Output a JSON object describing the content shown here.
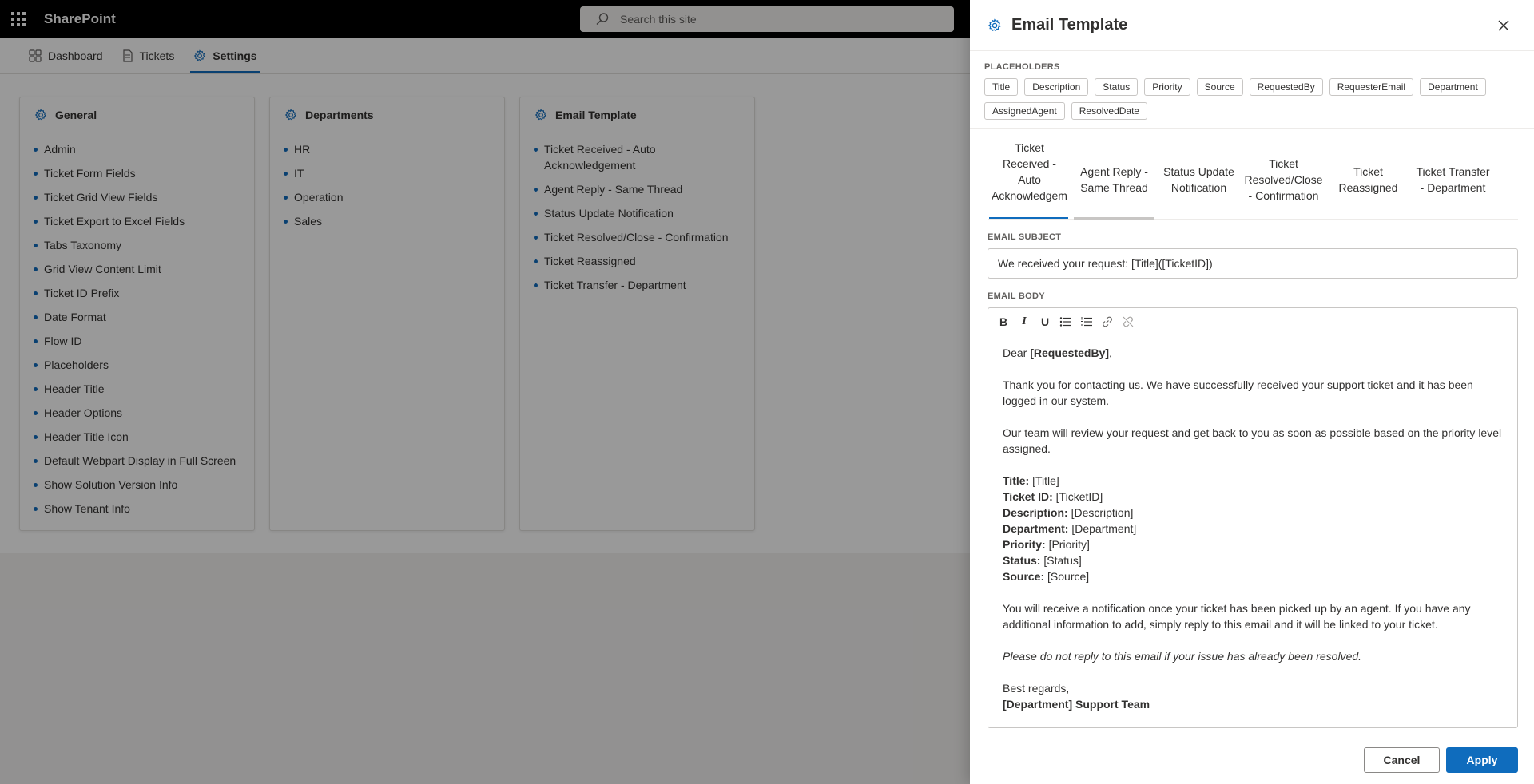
{
  "suitebar": {
    "brand": "SharePoint",
    "search_placeholder": "Search this site"
  },
  "nav": {
    "tabs": [
      "Dashboard",
      "Tickets",
      "Settings"
    ]
  },
  "cards": [
    {
      "title": "General",
      "items": [
        "Admin",
        "Ticket Form Fields",
        "Ticket Grid View Fields",
        "Ticket Export to Excel Fields",
        "Tabs Taxonomy",
        "Grid View Content Limit",
        "Ticket ID Prefix",
        "Date Format",
        "Flow ID",
        "Placeholders",
        "Header Title",
        "Header Options",
        "Header Title Icon",
        "Default Webpart Display in Full Screen",
        "Show Solution Version Info",
        "Show Tenant Info"
      ]
    },
    {
      "title": "Departments",
      "items": [
        "HR",
        "IT",
        "Operation",
        "Sales"
      ]
    },
    {
      "title": "Email Template",
      "items": [
        "Ticket Received - Auto Acknowledgement",
        "Agent Reply - Same Thread",
        "Status Update Notification",
        "Ticket Resolved/Close - Confirmation",
        "Ticket Reassigned",
        "Ticket Transfer - Department"
      ]
    }
  ],
  "panel": {
    "title": "Email Template",
    "placeholders_label": "PLACEHOLDERS",
    "placeholders": [
      "Title",
      "Description",
      "Status",
      "Priority",
      "Source",
      "RequestedBy",
      "RequesterEmail",
      "Department",
      "AssignedAgent",
      "ResolvedDate"
    ],
    "tabs": [
      "Ticket Received - Auto Acknowledgem",
      "Agent Reply - Same Thread",
      "Status Update Notification",
      "Ticket Resolved/Close - Confirmation",
      "Ticket Reassigned",
      "Ticket Transfer - Department"
    ],
    "subject_label": "EMAIL SUBJECT",
    "subject_value": "We received your request: [Title]([TicketID])",
    "body_label": "EMAIL BODY",
    "body": {
      "greeting_prefix": "Dear ",
      "greeting_name": "[RequestedBy]",
      "greeting_suffix": ",",
      "para1": "Thank you for contacting us. We have successfully received your support ticket and it has been logged in our system.",
      "para2": "Our team will review your request and get back to you as soon as possible based on the priority level assigned.",
      "fields": [
        {
          "label": "Title:",
          "value": " [Title]"
        },
        {
          "label": "Ticket ID:",
          "value": " [TicketID]"
        },
        {
          "label": "Description:",
          "value": " [Description]"
        },
        {
          "label": "Department:",
          "value": " [Department]"
        },
        {
          "label": "Priority:",
          "value": " [Priority]"
        },
        {
          "label": "Status:",
          "value": " [Status]"
        },
        {
          "label": "Source:",
          "value": " [Source]"
        }
      ],
      "para3": "You will receive a notification once your ticket has been picked up by an agent. If you have any additional information to add, simply reply to this email and it will be linked to your ticket.",
      "note": "Please do not reply to this email if your issue has already been resolved.",
      "closing": "Best regards,",
      "signature": "[Department] Support Team"
    },
    "cancel_label": "Cancel",
    "apply_label": "Apply"
  },
  "colors": {
    "accent": "#0f6cbd",
    "suitebar": "#000000"
  }
}
